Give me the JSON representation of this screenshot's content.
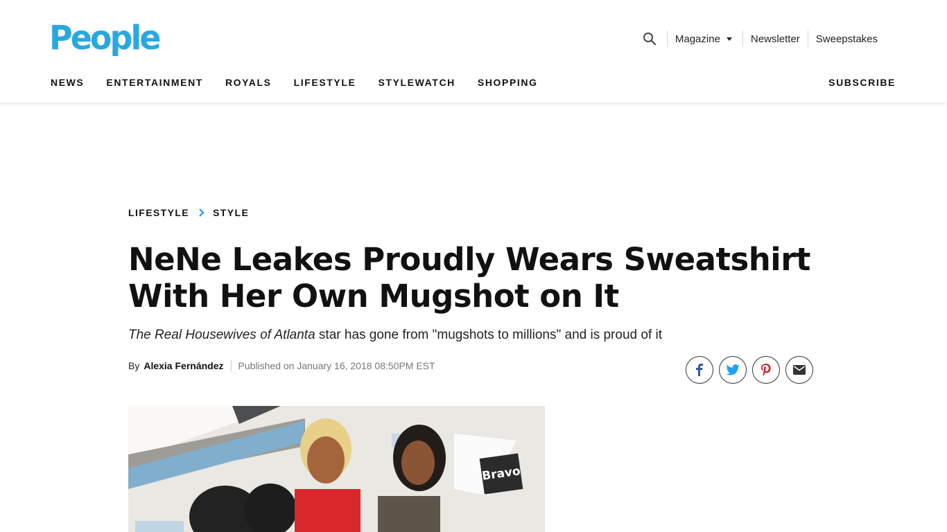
{
  "colors": {
    "brand": "#29a8e0",
    "text": "#111111",
    "muted": "#777777"
  },
  "header": {
    "logo": "People",
    "utility": {
      "search_icon": "search-icon",
      "magazine": "Magazine",
      "newsletter": "Newsletter",
      "sweepstakes": "Sweepstakes"
    },
    "nav": [
      "NEWS",
      "ENTERTAINMENT",
      "ROYALS",
      "LIFESTYLE",
      "STYLEWATCH",
      "SHOPPING"
    ],
    "subscribe": "SUBSCRIBE"
  },
  "article": {
    "breadcrumb": [
      "LIFESTYLE",
      "STYLE"
    ],
    "headline": "NeNe Leakes Proudly Wears Sweatshirt With Her Own Mugshot on It",
    "dek_italic": "The Real Housewives of Atlanta",
    "dek_rest": " star has gone from \"mugshots to millions\" and is proud of it",
    "byline_prefix": "By",
    "author": "Alexia Fernández",
    "published": "Published on January 16, 2018 08:50PM EST",
    "share": [
      "facebook-icon",
      "twitter-icon",
      "pinterest-icon",
      "email-icon"
    ],
    "photo_sign": "Bravo"
  }
}
